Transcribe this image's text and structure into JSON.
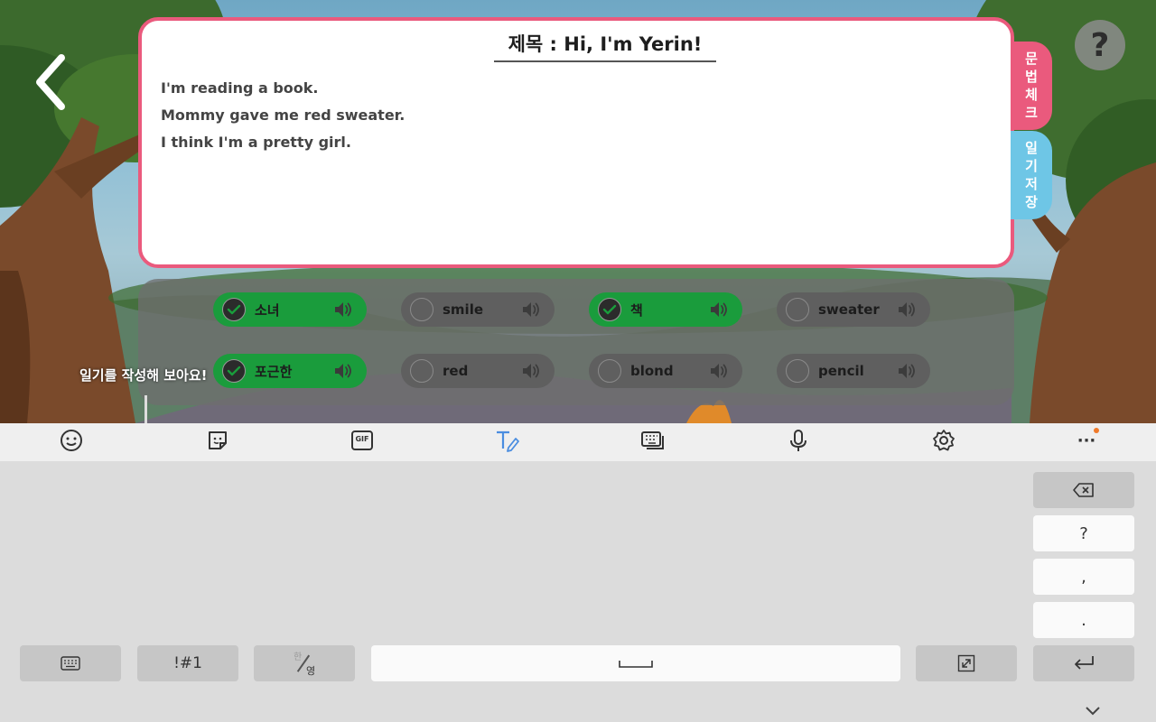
{
  "diary": {
    "title": "제목 : Hi, I'm Yerin!",
    "lines": [
      "I'm reading a book.",
      "Mommy gave me red sweater.",
      "I think I'm a pretty girl."
    ]
  },
  "side_tabs": {
    "grammar_check": "문법체크",
    "save_diary": "일기저장"
  },
  "help": {
    "label": "?"
  },
  "words": [
    {
      "label": "소녀",
      "checked": true
    },
    {
      "label": "smile",
      "checked": false
    },
    {
      "label": "책",
      "checked": true
    },
    {
      "label": "sweater",
      "checked": false
    },
    {
      "label": "포근한",
      "checked": true
    },
    {
      "label": "red",
      "checked": false
    },
    {
      "label": "blond",
      "checked": false
    },
    {
      "label": "pencil",
      "checked": false
    }
  ],
  "hint": "일기를 작성해 보아요!",
  "keyboard": {
    "toolbar_icons": [
      "emoji-icon",
      "sticker-icon",
      "gif-icon",
      "handwriting-icon",
      "keyboard-mode-icon",
      "microphone-icon",
      "settings-icon",
      "more-icon"
    ],
    "gif_label": "GIF",
    "more_label": "···",
    "keys": {
      "question": "?",
      "comma": ",",
      "period": ".",
      "symbols": "!#1",
      "lang_top": "한",
      "lang_bottom": "영"
    }
  },
  "colors": {
    "card_border": "#ea5a7d",
    "grammar_tab": "#ea5a7d",
    "save_tab": "#6ec6e6",
    "chip_checked": "#1a9c3c",
    "chip_unchecked": "#5f5f5f",
    "accent_icon": "#4a8de0"
  }
}
